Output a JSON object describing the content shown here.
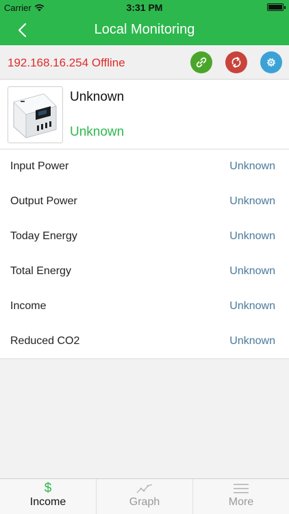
{
  "status_bar": {
    "carrier": "Carrier",
    "time": "3:31 PM"
  },
  "nav": {
    "title": "Local Monitoring",
    "back_icon": "chevron-left-icon"
  },
  "device": {
    "ip_status": "192.168.16.254 Offline",
    "actions": [
      {
        "icon": "link-icon",
        "color": "#4aa62a"
      },
      {
        "icon": "sync-icon",
        "color": "#c8443a"
      },
      {
        "icon": "gear-icon",
        "color": "#3aa2d6"
      }
    ]
  },
  "inverter": {
    "name": "Unknown",
    "status": "Unknown"
  },
  "metrics": [
    {
      "label": "Input Power",
      "value": "Unknown"
    },
    {
      "label": "Output Power",
      "value": "Unknown"
    },
    {
      "label": "Today Energy",
      "value": "Unknown"
    },
    {
      "label": "Total Energy",
      "value": "Unknown"
    },
    {
      "label": "Income",
      "value": "Unknown"
    },
    {
      "label": "Reduced CO2",
      "value": "Unknown"
    }
  ],
  "tabs": [
    {
      "label": "Income",
      "icon": "dollar-icon",
      "active": true
    },
    {
      "label": "Graph",
      "icon": "graph-icon",
      "active": false
    },
    {
      "label": "More",
      "icon": "menu-icon",
      "active": false
    }
  ],
  "colors": {
    "accent": "#2db84d",
    "offline": "#e02a2a",
    "value": "#4a7a9a"
  }
}
